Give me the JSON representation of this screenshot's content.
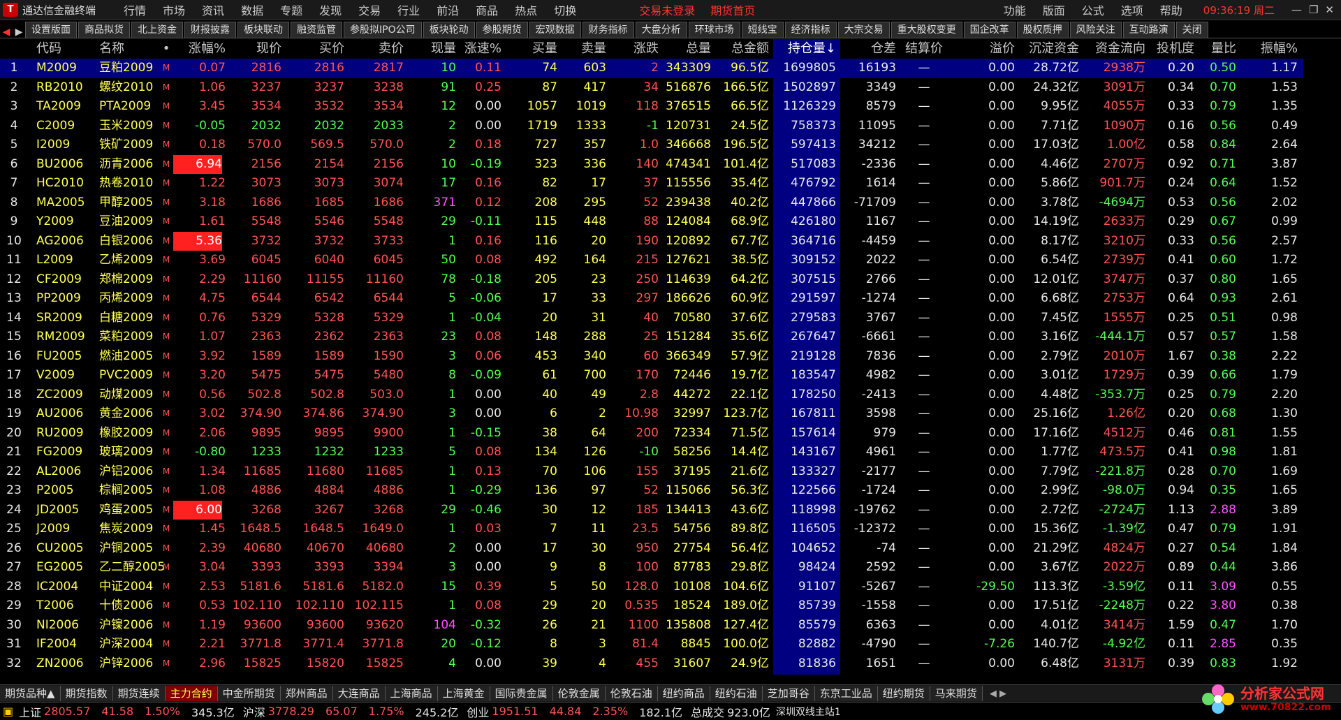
{
  "titlebar": {
    "title": "通达信金融终端",
    "menus": [
      "行情",
      "市场",
      "资讯",
      "数据",
      "专题",
      "发现",
      "交易",
      "行业",
      "前沿",
      "商品",
      "热点",
      "切换"
    ],
    "trade_status": "交易未登录",
    "futures_home": "期货首页",
    "right_menus": [
      "功能",
      "版面",
      "公式",
      "选项",
      "帮助"
    ],
    "clock": "09:36:19",
    "weekday": "周二",
    "logo": "T"
  },
  "toptabs": [
    "设置版面",
    "商品拟货",
    "北上资金",
    "财报披露",
    "板块联动",
    "融资监管",
    "参股拟IPO公司",
    "板块轮动",
    "参股期货",
    "宏观数据",
    "财务指标",
    "大盘分析",
    "环球市场",
    "短线宝",
    "经济指标",
    "大宗交易",
    "重大股权变更",
    "国企改革",
    "股权质押",
    "风险关注",
    "互动路演",
    "关闭"
  ],
  "columns": [
    "",
    "代码",
    "名称",
    "•",
    "涨幅%",
    "现价",
    "买价",
    "卖价",
    "现量",
    "涨速%",
    "买量",
    "卖量",
    "涨跌",
    "总量",
    "总金额",
    "持仓量↓",
    "仓差",
    "结算价",
    "溢价",
    "沉淀资金",
    "资金流向",
    "投机度",
    "量比",
    "振幅%"
  ],
  "rows": [
    {
      "n": "1",
      "code": "M2009",
      "name": "豆粕2009",
      "m": "M",
      "pct": "0.07",
      "price": "2816",
      "bid": "2816",
      "ask": "2817",
      "vol": "10",
      "spd": "0.11",
      "bv": "74",
      "av": "603",
      "chg": "2",
      "tot": "343309",
      "amt": "96.5亿",
      "oi": "1699805",
      "od": "16193",
      "settle": "—",
      "prem": "0.00",
      "cap": "28.72亿",
      "flow": "2938万",
      "spec": "0.20",
      "vr": "0.50",
      "amp": "1.17"
    },
    {
      "n": "2",
      "code": "RB2010",
      "name": "螺纹2010",
      "m": "M",
      "pct": "1.06",
      "price": "3237",
      "bid": "3237",
      "ask": "3238",
      "vol": "91",
      "spd": "0.25",
      "bv": "87",
      "av": "417",
      "chg": "34",
      "tot": "516876",
      "amt": "166.5亿",
      "oi": "1502897",
      "od": "3349",
      "settle": "—",
      "prem": "0.00",
      "cap": "24.32亿",
      "flow": "3091万",
      "spec": "0.34",
      "vr": "0.70",
      "amp": "1.53"
    },
    {
      "n": "3",
      "code": "TA2009",
      "name": "PTA2009",
      "m": "M",
      "pct": "3.45",
      "price": "3534",
      "bid": "3532",
      "ask": "3534",
      "vol": "12",
      "spd": "0.00",
      "bv": "1057",
      "av": "1019",
      "chg": "118",
      "tot": "376515",
      "amt": "66.5亿",
      "oi": "1126329",
      "od": "8579",
      "settle": "—",
      "prem": "0.00",
      "cap": "9.95亿",
      "flow": "4055万",
      "spec": "0.33",
      "vr": "0.79",
      "amp": "1.35"
    },
    {
      "n": "4",
      "code": "C2009",
      "name": "玉米2009",
      "m": "M",
      "pct": "-0.05",
      "price": "2032",
      "bid": "2032",
      "ask": "2033",
      "vol": "2",
      "spd": "0.00",
      "bv": "1719",
      "av": "1333",
      "chg": "-1",
      "tot": "120731",
      "amt": "24.5亿",
      "oi": "758373",
      "od": "11095",
      "settle": "—",
      "prem": "0.00",
      "cap": "7.71亿",
      "flow": "1090万",
      "spec": "0.16",
      "vr": "0.56",
      "amp": "0.49"
    },
    {
      "n": "5",
      "code": "I2009",
      "name": "铁矿2009",
      "m": "M",
      "pct": "0.18",
      "price": "570.0",
      "bid": "569.5",
      "ask": "570.0",
      "vol": "2",
      "spd": "0.18",
      "bv": "727",
      "av": "357",
      "chg": "1.0",
      "tot": "346668",
      "amt": "196.5亿",
      "oi": "597413",
      "od": "34212",
      "settle": "—",
      "prem": "0.00",
      "cap": "17.03亿",
      "flow": "1.00亿",
      "spec": "0.58",
      "vr": "0.84",
      "amp": "2.64"
    },
    {
      "n": "6",
      "code": "BU2006",
      "name": "沥青2006",
      "m": "M",
      "pct": "6.94",
      "price": "2156",
      "bid": "2154",
      "ask": "2156",
      "vol": "10",
      "spd": "-0.19",
      "bv": "323",
      "av": "336",
      "chg": "140",
      "tot": "474341",
      "amt": "101.4亿",
      "oi": "517083",
      "od": "-2336",
      "settle": "—",
      "prem": "0.00",
      "cap": "4.46亿",
      "flow": "2707万",
      "spec": "0.92",
      "vr": "0.71",
      "amp": "3.87"
    },
    {
      "n": "7",
      "code": "HC2010",
      "name": "热卷2010",
      "m": "M",
      "pct": "1.22",
      "price": "3073",
      "bid": "3073",
      "ask": "3074",
      "vol": "17",
      "spd": "0.16",
      "bv": "82",
      "av": "17",
      "chg": "37",
      "tot": "115556",
      "amt": "35.4亿",
      "oi": "476792",
      "od": "1614",
      "settle": "—",
      "prem": "0.00",
      "cap": "5.86亿",
      "flow": "901.7万",
      "spec": "0.24",
      "vr": "0.64",
      "amp": "1.52"
    },
    {
      "n": "8",
      "code": "MA2005",
      "name": "甲醇2005",
      "m": "M",
      "pct": "3.18",
      "price": "1686",
      "bid": "1685",
      "ask": "1686",
      "vol": "371",
      "spd": "0.12",
      "bv": "208",
      "av": "295",
      "chg": "52",
      "tot": "239438",
      "amt": "40.2亿",
      "oi": "447866",
      "od": "-71709",
      "settle": "—",
      "prem": "0.00",
      "cap": "3.78亿",
      "flow": "-4694万",
      "spec": "0.53",
      "vr": "0.56",
      "amp": "2.02"
    },
    {
      "n": "9",
      "code": "Y2009",
      "name": "豆油2009",
      "m": "M",
      "pct": "1.61",
      "price": "5548",
      "bid": "5546",
      "ask": "5548",
      "vol": "29",
      "spd": "-0.11",
      "bv": "115",
      "av": "448",
      "chg": "88",
      "tot": "124084",
      "amt": "68.9亿",
      "oi": "426180",
      "od": "1167",
      "settle": "—",
      "prem": "0.00",
      "cap": "14.19亿",
      "flow": "2633万",
      "spec": "0.29",
      "vr": "0.67",
      "amp": "0.99"
    },
    {
      "n": "10",
      "code": "AG2006",
      "name": "白银2006",
      "m": "M",
      "pct": "5.36",
      "price": "3732",
      "bid": "3732",
      "ask": "3733",
      "vol": "1",
      "spd": "0.16",
      "bv": "116",
      "av": "20",
      "chg": "190",
      "tot": "120892",
      "amt": "67.7亿",
      "oi": "364716",
      "od": "-4459",
      "settle": "—",
      "prem": "0.00",
      "cap": "8.17亿",
      "flow": "3210万",
      "spec": "0.33",
      "vr": "0.56",
      "amp": "2.57"
    },
    {
      "n": "11",
      "code": "L2009",
      "name": "乙烯2009",
      "m": "M",
      "pct": "3.69",
      "price": "6045",
      "bid": "6040",
      "ask": "6045",
      "vol": "50",
      "spd": "0.08",
      "bv": "492",
      "av": "164",
      "chg": "215",
      "tot": "127621",
      "amt": "38.5亿",
      "oi": "309152",
      "od": "2022",
      "settle": "—",
      "prem": "0.00",
      "cap": "6.54亿",
      "flow": "2739万",
      "spec": "0.41",
      "vr": "0.60",
      "amp": "1.72"
    },
    {
      "n": "12",
      "code": "CF2009",
      "name": "郑棉2009",
      "m": "M",
      "pct": "2.29",
      "price": "11160",
      "bid": "11155",
      "ask": "11160",
      "vol": "78",
      "spd": "-0.18",
      "bv": "205",
      "av": "23",
      "chg": "250",
      "tot": "114639",
      "amt": "64.2亿",
      "oi": "307515",
      "od": "2766",
      "settle": "—",
      "prem": "0.00",
      "cap": "12.01亿",
      "flow": "3747万",
      "spec": "0.37",
      "vr": "0.80",
      "amp": "1.65"
    },
    {
      "n": "13",
      "code": "PP2009",
      "name": "丙烯2009",
      "m": "M",
      "pct": "4.75",
      "price": "6544",
      "bid": "6542",
      "ask": "6544",
      "vol": "5",
      "spd": "-0.06",
      "bv": "17",
      "av": "33",
      "chg": "297",
      "tot": "186626",
      "amt": "60.9亿",
      "oi": "291597",
      "od": "-1274",
      "settle": "—",
      "prem": "0.00",
      "cap": "6.68亿",
      "flow": "2753万",
      "spec": "0.64",
      "vr": "0.93",
      "amp": "2.61"
    },
    {
      "n": "14",
      "code": "SR2009",
      "name": "白糖2009",
      "m": "M",
      "pct": "0.76",
      "price": "5329",
      "bid": "5328",
      "ask": "5329",
      "vol": "1",
      "spd": "-0.04",
      "bv": "20",
      "av": "31",
      "chg": "40",
      "tot": "70580",
      "amt": "37.6亿",
      "oi": "279583",
      "od": "3767",
      "settle": "—",
      "prem": "0.00",
      "cap": "7.45亿",
      "flow": "1555万",
      "spec": "0.25",
      "vr": "0.51",
      "amp": "0.98"
    },
    {
      "n": "15",
      "code": "RM2009",
      "name": "菜粕2009",
      "m": "M",
      "pct": "1.07",
      "price": "2363",
      "bid": "2362",
      "ask": "2363",
      "vol": "23",
      "spd": "0.08",
      "bv": "148",
      "av": "288",
      "chg": "25",
      "tot": "151284",
      "amt": "35.6亿",
      "oi": "267647",
      "od": "-6661",
      "settle": "—",
      "prem": "0.00",
      "cap": "3.16亿",
      "flow": "-444.1万",
      "spec": "0.57",
      "vr": "0.57",
      "amp": "1.58"
    },
    {
      "n": "16",
      "code": "FU2005",
      "name": "燃油2005",
      "m": "M",
      "pct": "3.92",
      "price": "1589",
      "bid": "1589",
      "ask": "1590",
      "vol": "3",
      "spd": "0.06",
      "bv": "453",
      "av": "340",
      "chg": "60",
      "tot": "366349",
      "amt": "57.9亿",
      "oi": "219128",
      "od": "7836",
      "settle": "—",
      "prem": "0.00",
      "cap": "2.79亿",
      "flow": "2010万",
      "spec": "1.67",
      "vr": "0.38",
      "amp": "2.22"
    },
    {
      "n": "17",
      "code": "V2009",
      "name": "PVC2009",
      "m": "M",
      "pct": "3.20",
      "price": "5475",
      "bid": "5475",
      "ask": "5480",
      "vol": "8",
      "spd": "-0.09",
      "bv": "61",
      "av": "700",
      "chg": "170",
      "tot": "72446",
      "amt": "19.7亿",
      "oi": "183547",
      "od": "4982",
      "settle": "—",
      "prem": "0.00",
      "cap": "3.01亿",
      "flow": "1729万",
      "spec": "0.39",
      "vr": "0.66",
      "amp": "1.79"
    },
    {
      "n": "18",
      "code": "ZC2009",
      "name": "动煤2009",
      "m": "M",
      "pct": "0.56",
      "price": "502.8",
      "bid": "502.8",
      "ask": "503.0",
      "vol": "1",
      "spd": "0.00",
      "bv": "40",
      "av": "49",
      "chg": "2.8",
      "tot": "44272",
      "amt": "22.1亿",
      "oi": "178250",
      "od": "-2413",
      "settle": "—",
      "prem": "0.00",
      "cap": "4.48亿",
      "flow": "-353.7万",
      "spec": "0.25",
      "vr": "0.79",
      "amp": "2.20"
    },
    {
      "n": "19",
      "code": "AU2006",
      "name": "黄金2006",
      "m": "M",
      "pct": "3.02",
      "price": "374.90",
      "bid": "374.86",
      "ask": "374.90",
      "vol": "3",
      "spd": "0.00",
      "bv": "6",
      "av": "2",
      "chg": "10.98",
      "tot": "32997",
      "amt": "123.7亿",
      "oi": "167811",
      "od": "3598",
      "settle": "—",
      "prem": "0.00",
      "cap": "25.16亿",
      "flow": "1.26亿",
      "spec": "0.20",
      "vr": "0.68",
      "amp": "1.30"
    },
    {
      "n": "20",
      "code": "RU2009",
      "name": "橡胶2009",
      "m": "M",
      "pct": "2.06",
      "price": "9895",
      "bid": "9895",
      "ask": "9900",
      "vol": "1",
      "spd": "-0.15",
      "bv": "38",
      "av": "64",
      "chg": "200",
      "tot": "72334",
      "amt": "71.5亿",
      "oi": "157614",
      "od": "979",
      "settle": "—",
      "prem": "0.00",
      "cap": "17.16亿",
      "flow": "4512万",
      "spec": "0.46",
      "vr": "0.81",
      "amp": "1.55"
    },
    {
      "n": "21",
      "code": "FG2009",
      "name": "玻璃2009",
      "m": "M",
      "pct": "-0.80",
      "price": "1233",
      "bid": "1232",
      "ask": "1233",
      "vol": "5",
      "spd": "0.08",
      "bv": "134",
      "av": "126",
      "chg": "-10",
      "tot": "58256",
      "amt": "14.4亿",
      "oi": "143167",
      "od": "4961",
      "settle": "—",
      "prem": "0.00",
      "cap": "1.77亿",
      "flow": "473.5万",
      "spec": "0.41",
      "vr": "0.98",
      "amp": "1.81"
    },
    {
      "n": "22",
      "code": "AL2006",
      "name": "沪铝2006",
      "m": "M",
      "pct": "1.34",
      "price": "11685",
      "bid": "11680",
      "ask": "11685",
      "vol": "1",
      "spd": "0.13",
      "bv": "70",
      "av": "106",
      "chg": "155",
      "tot": "37195",
      "amt": "21.6亿",
      "oi": "133327",
      "od": "-2177",
      "settle": "—",
      "prem": "0.00",
      "cap": "7.79亿",
      "flow": "-221.8万",
      "spec": "0.28",
      "vr": "0.70",
      "amp": "1.69"
    },
    {
      "n": "23",
      "code": "P2005",
      "name": "棕榈2005",
      "m": "M",
      "pct": "1.08",
      "price": "4886",
      "bid": "4884",
      "ask": "4886",
      "vol": "1",
      "spd": "-0.29",
      "bv": "136",
      "av": "97",
      "chg": "52",
      "tot": "115066",
      "amt": "56.3亿",
      "oi": "122566",
      "od": "-1724",
      "settle": "—",
      "prem": "0.00",
      "cap": "2.99亿",
      "flow": "-98.0万",
      "spec": "0.94",
      "vr": "0.35",
      "amp": "1.65"
    },
    {
      "n": "24",
      "code": "JD2005",
      "name": "鸡蛋2005",
      "m": "M",
      "pct": "6.00",
      "price": "3268",
      "bid": "3267",
      "ask": "3268",
      "vol": "29",
      "spd": "-0.46",
      "bv": "30",
      "av": "12",
      "chg": "185",
      "tot": "134413",
      "amt": "43.6亿",
      "oi": "118998",
      "od": "-19762",
      "settle": "—",
      "prem": "0.00",
      "cap": "2.72亿",
      "flow": "-2724万",
      "spec": "1.13",
      "vr": "2.88",
      "amp": "3.89"
    },
    {
      "n": "25",
      "code": "J2009",
      "name": "焦炭2009",
      "m": "M",
      "pct": "1.45",
      "price": "1648.5",
      "bid": "1648.5",
      "ask": "1649.0",
      "vol": "1",
      "spd": "0.03",
      "bv": "7",
      "av": "11",
      "chg": "23.5",
      "tot": "54756",
      "amt": "89.8亿",
      "oi": "116505",
      "od": "-12372",
      "settle": "—",
      "prem": "0.00",
      "cap": "15.36亿",
      "flow": "-1.39亿",
      "spec": "0.47",
      "vr": "0.79",
      "amp": "1.91"
    },
    {
      "n": "26",
      "code": "CU2005",
      "name": "沪铜2005",
      "m": "M",
      "pct": "2.39",
      "price": "40680",
      "bid": "40670",
      "ask": "40680",
      "vol": "2",
      "spd": "0.00",
      "bv": "17",
      "av": "30",
      "chg": "950",
      "tot": "27754",
      "amt": "56.4亿",
      "oi": "104652",
      "od": "-74",
      "settle": "—",
      "prem": "0.00",
      "cap": "21.29亿",
      "flow": "4824万",
      "spec": "0.27",
      "vr": "0.54",
      "amp": "1.84"
    },
    {
      "n": "27",
      "code": "EG2005",
      "name": "乙二醇2005",
      "m": "M",
      "pct": "3.04",
      "price": "3393",
      "bid": "3393",
      "ask": "3394",
      "vol": "3",
      "spd": "0.00",
      "bv": "9",
      "av": "8",
      "chg": "100",
      "tot": "87783",
      "amt": "29.8亿",
      "oi": "98424",
      "od": "2592",
      "settle": "—",
      "prem": "0.00",
      "cap": "3.67亿",
      "flow": "2022万",
      "spec": "0.89",
      "vr": "0.44",
      "amp": "3.86"
    },
    {
      "n": "28",
      "code": "IC2004",
      "name": "中证2004",
      "m": "M",
      "pct": "2.53",
      "price": "5181.6",
      "bid": "5181.6",
      "ask": "5182.0",
      "vol": "15",
      "spd": "0.39",
      "bv": "5",
      "av": "50",
      "chg": "128.0",
      "tot": "10108",
      "amt": "104.6亿",
      "oi": "91107",
      "od": "-5267",
      "settle": "—",
      "prem": "-29.50",
      "cap": "113.3亿",
      "flow": "-3.59亿",
      "spec": "0.11",
      "vr": "3.09",
      "amp": "0.55"
    },
    {
      "n": "29",
      "code": "T2006",
      "name": "十债2006",
      "m": "M",
      "pct": "0.53",
      "price": "102.110",
      "bid": "102.110",
      "ask": "102.115",
      "vol": "1",
      "spd": "0.08",
      "bv": "29",
      "av": "20",
      "chg": "0.535",
      "tot": "18524",
      "amt": "189.0亿",
      "oi": "85739",
      "od": "-1558",
      "settle": "—",
      "prem": "0.00",
      "cap": "17.51亿",
      "flow": "-2248万",
      "spec": "0.22",
      "vr": "3.80",
      "amp": "0.38"
    },
    {
      "n": "30",
      "code": "NI2006",
      "name": "沪镍2006",
      "m": "M",
      "pct": "1.19",
      "price": "93600",
      "bid": "93600",
      "ask": "93620",
      "vol": "104",
      "spd": "-0.32",
      "bv": "26",
      "av": "21",
      "chg": "1100",
      "tot": "135808",
      "amt": "127.4亿",
      "oi": "85579",
      "od": "6363",
      "settle": "—",
      "prem": "0.00",
      "cap": "4.01亿",
      "flow": "3414万",
      "spec": "1.59",
      "vr": "0.47",
      "amp": "1.70"
    },
    {
      "n": "31",
      "code": "IF2004",
      "name": "沪深2004",
      "m": "M",
      "pct": "2.21",
      "price": "3771.8",
      "bid": "3771.4",
      "ask": "3771.8",
      "vol": "20",
      "spd": "-0.12",
      "bv": "8",
      "av": "3",
      "chg": "81.4",
      "tot": "8845",
      "amt": "100.0亿",
      "oi": "82882",
      "od": "-4790",
      "settle": "—",
      "prem": "-7.26",
      "cap": "140.7亿",
      "flow": "-4.92亿",
      "spec": "0.11",
      "vr": "2.85",
      "amp": "0.35"
    },
    {
      "n": "32",
      "code": "ZN2006",
      "name": "沪锌2006",
      "m": "M",
      "pct": "2.96",
      "price": "15825",
      "bid": "15820",
      "ask": "15825",
      "vol": "4",
      "spd": "0.00",
      "bv": "39",
      "av": "4",
      "chg": "455",
      "tot": "31607",
      "amt": "24.9亿",
      "oi": "81836",
      "od": "1651",
      "settle": "—",
      "prem": "0.00",
      "cap": "6.48亿",
      "flow": "3131万",
      "spec": "0.39",
      "vr": "0.83",
      "amp": "1.92"
    }
  ],
  "bottomtabs": [
    "期货品种▲",
    "期货指数",
    "期货连续",
    "主力合约",
    "中金所期货",
    "郑州商品",
    "大连商品",
    "上海商品",
    "上海黄金",
    "国际贵金属",
    "伦敦金属",
    "伦敦石油",
    "纽约商品",
    "纽约石油",
    "芝加哥谷",
    "东京工业品",
    "纽约期货",
    "马来期货"
  ],
  "status": {
    "sh_label": "上证",
    "sh_val": "2805.57",
    "sh_chg": "41.58",
    "sh_pct": "1.50%",
    "sh_amt": "345.3亿",
    "sz_label": "沪深",
    "sz_val": "3778.29",
    "sz_chg": "65.07",
    "sz_pct": "1.75%",
    "sz_amt": "245.2亿",
    "cy_label": "创业",
    "cy_val": "1951.51",
    "cy_chg": "44.84",
    "cy_pct": "2.35%",
    "cy_amt": "182.1亿",
    "total_label": "总成交",
    "total_amt": "923.0亿",
    "server": "深圳双线主站1"
  },
  "brand": {
    "name": "分析家公式网",
    "url": "www.70822.com"
  },
  "colors": {
    "red": "#ff5454",
    "green": "#54ff54",
    "yellow": "#ffff54",
    "selected": "#000080"
  }
}
